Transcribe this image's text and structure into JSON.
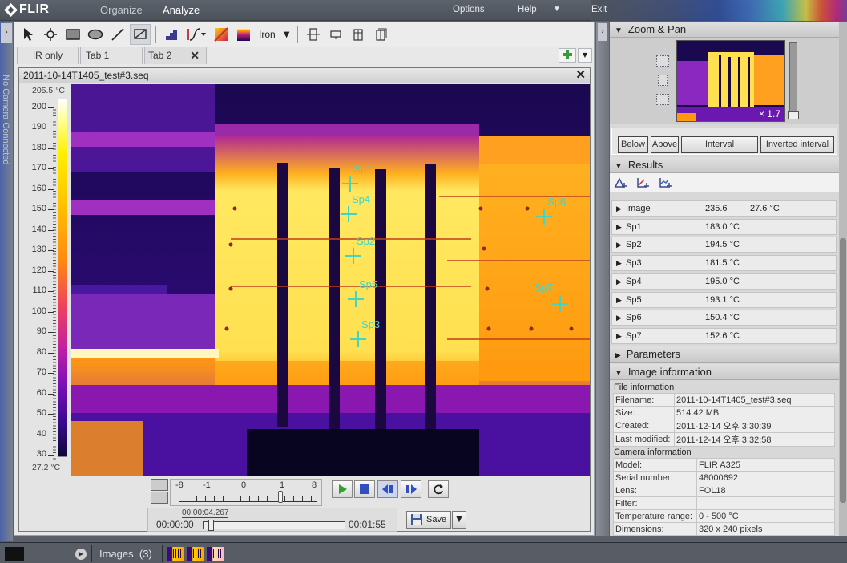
{
  "app": {
    "brand": "FLIR",
    "nav": [
      "Organize",
      "Analyze"
    ],
    "active_nav": "Analyze",
    "menu": {
      "options": "Options",
      "help": "Help",
      "exit": "Exit"
    },
    "side_status": "No Camera Connected"
  },
  "toolbar": {
    "tools": [
      "select-tool",
      "spot-tool",
      "box-tool",
      "ellipse-tool",
      "line-tool",
      "delete-measurement-tool"
    ],
    "palette_label": "Iron"
  },
  "tabs": [
    {
      "label": "IR only"
    },
    {
      "label": "Tab 1"
    },
    {
      "label": "Tab 2",
      "selected": true
    }
  ],
  "image_window": {
    "title": "2011-10-14T1405_test#3.seq",
    "scale": {
      "max": "205.5",
      "min": "27.2",
      "unit": "°C",
      "ticks": [
        "200",
        "190",
        "180",
        "170",
        "160",
        "150",
        "140",
        "130",
        "120",
        "110",
        "100",
        "90",
        "80",
        "70",
        "60",
        "50",
        "40",
        "30"
      ]
    },
    "spots": [
      {
        "label": "Sp1"
      },
      {
        "label": "Sp2"
      },
      {
        "label": "Sp3"
      },
      {
        "label": "Sp4"
      },
      {
        "label": "Sp5"
      },
      {
        "label": "Sp6"
      },
      {
        "label": "Sp7"
      }
    ]
  },
  "playback": {
    "speed_labels": [
      "-8",
      "-1",
      "0",
      "1",
      "8"
    ],
    "speed_value": "1",
    "current_time": "00:00:04.267",
    "start_time": "00:00:00",
    "end_time": "00:01:55",
    "position_fraction": 0.037,
    "save_label": "Save"
  },
  "right_panel": {
    "zoom_pan": {
      "title": "Zoom & Pan",
      "zoom_label": "× 1.7"
    },
    "isotherm_buttons": [
      "Below",
      "Above",
      "Interval",
      "Inverted interval"
    ],
    "results": {
      "title": "Results",
      "rows": [
        {
          "name": "Image",
          "value": "235.6",
          "value2": "27.6 °C"
        },
        {
          "name": "Sp1",
          "value": "183.0 °C"
        },
        {
          "name": "Sp2",
          "value": "194.5 °C"
        },
        {
          "name": "Sp3",
          "value": "181.5 °C"
        },
        {
          "name": "Sp4",
          "value": "195.0 °C"
        },
        {
          "name": "Sp5",
          "value": "193.1 °C"
        },
        {
          "name": "Sp6",
          "value": "150.4 °C"
        },
        {
          "name": "Sp7",
          "value": "152.6 °C"
        }
      ]
    },
    "parameters_title": "Parameters",
    "image_info": {
      "title": "Image information",
      "file_info_title": "File information",
      "file_info": [
        {
          "k": "Filename:",
          "v": "2011-10-14T1405_test#3.seq"
        },
        {
          "k": "Size:",
          "v": "514.42 MB"
        },
        {
          "k": "Created:",
          "v": "2011-12-14 오후 3:30:39"
        },
        {
          "k": "Last modified:",
          "v": "2011-12-14 오후 3:32:58"
        }
      ],
      "camera_info_title": "Camera information",
      "camera_info": [
        {
          "k": "Model:",
          "v": "FLIR A325"
        },
        {
          "k": "Serial number:",
          "v": "48000692"
        },
        {
          "k": "Lens:",
          "v": "FOL18"
        },
        {
          "k": "Filter:",
          "v": ""
        },
        {
          "k": "Temperature range:",
          "v": "0 - 500 °C"
        },
        {
          "k": "Dimensions:",
          "v": "320 x 240 pixels"
        }
      ]
    }
  },
  "filmstrip": {
    "label": "Images",
    "count": "(3)"
  }
}
